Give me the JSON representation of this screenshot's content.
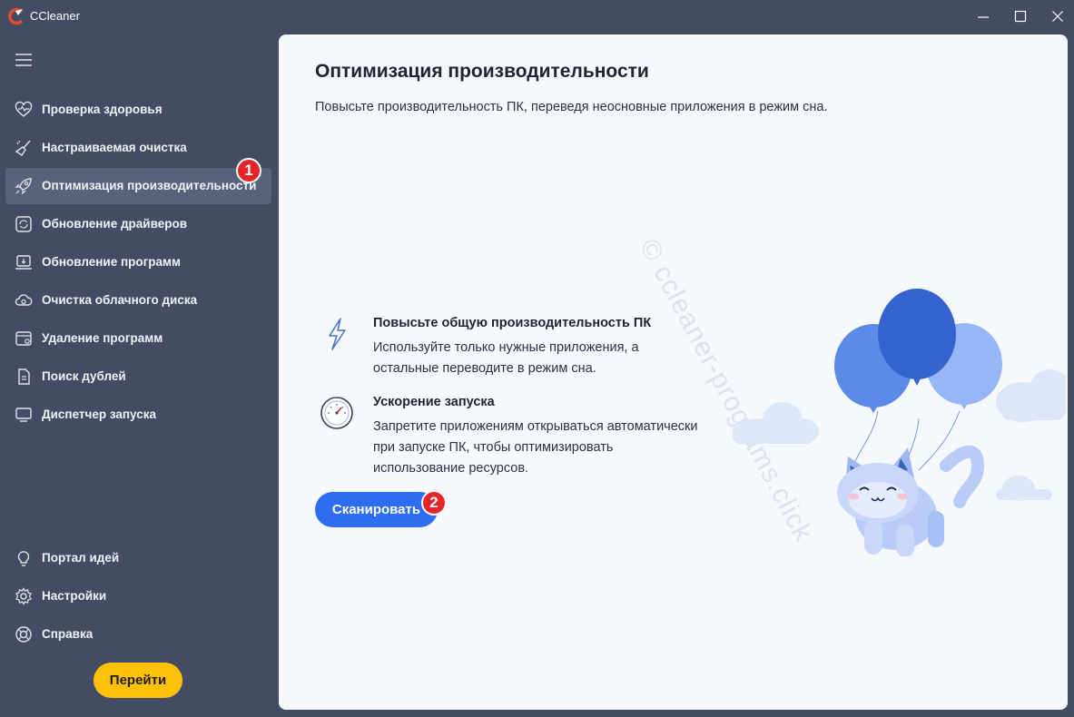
{
  "window": {
    "title": "CCleaner",
    "logo_icon": "ccleaner-logo-icon",
    "controls": [
      "minimize-icon",
      "maximize-icon",
      "close-icon"
    ]
  },
  "sidebar": {
    "menu_icon": "hamburger-menu-icon",
    "items": [
      {
        "label": "Проверка здоровья",
        "icon": "heart-icon",
        "active": false
      },
      {
        "label": "Настраиваемая очистка",
        "icon": "broom-icon",
        "active": false
      },
      {
        "label": "Оптимизация производительности",
        "icon": "rocket-icon",
        "active": true
      },
      {
        "label": "Обновление драйверов",
        "icon": "driver-update-icon",
        "active": false
      },
      {
        "label": "Обновление программ",
        "icon": "software-update-icon",
        "active": false
      },
      {
        "label": "Очистка облачного диска",
        "icon": "cloud-drive-icon",
        "active": false
      },
      {
        "label": "Удаление программ",
        "icon": "uninstall-icon",
        "active": false
      },
      {
        "label": "Поиск дублей",
        "icon": "duplicate-file-icon",
        "active": false
      },
      {
        "label": "Диспетчер запуска",
        "icon": "monitor-icon",
        "active": false
      }
    ],
    "bottom_items": [
      {
        "label": "Портал идей",
        "icon": "lightbulb-icon"
      },
      {
        "label": "Настройки",
        "icon": "gear-icon"
      },
      {
        "label": "Справка",
        "icon": "help-icon"
      }
    ],
    "go_button": "Перейти"
  },
  "markers": {
    "first": "1",
    "second": "2"
  },
  "main": {
    "title": "Оптимизация производительности",
    "subtitle": "Повысьте производительность ПК, переведя неосновные приложения в режим сна.",
    "features": [
      {
        "icon": "lightning-icon",
        "title": "Повысьте общую производительность ПК",
        "description": "Используйте только нужные приложения, а остальные переводите в режим сна."
      },
      {
        "icon": "speedometer-icon",
        "title": "Ускорение запуска",
        "description": "Запретите приложениям открываться автоматически при запуске ПК, чтобы оптимизировать использование ресурсов."
      }
    ],
    "scan_button": "Сканировать",
    "watermark": "© ccleaner-programs.click"
  },
  "colors": {
    "sidebar_bg": "#434c63",
    "active_item_bg": "#58627b",
    "main_bg": "#f5f8fd",
    "scan_button": "#2e6df0",
    "go_button": "#ffc107",
    "marker": "#e5252a"
  }
}
